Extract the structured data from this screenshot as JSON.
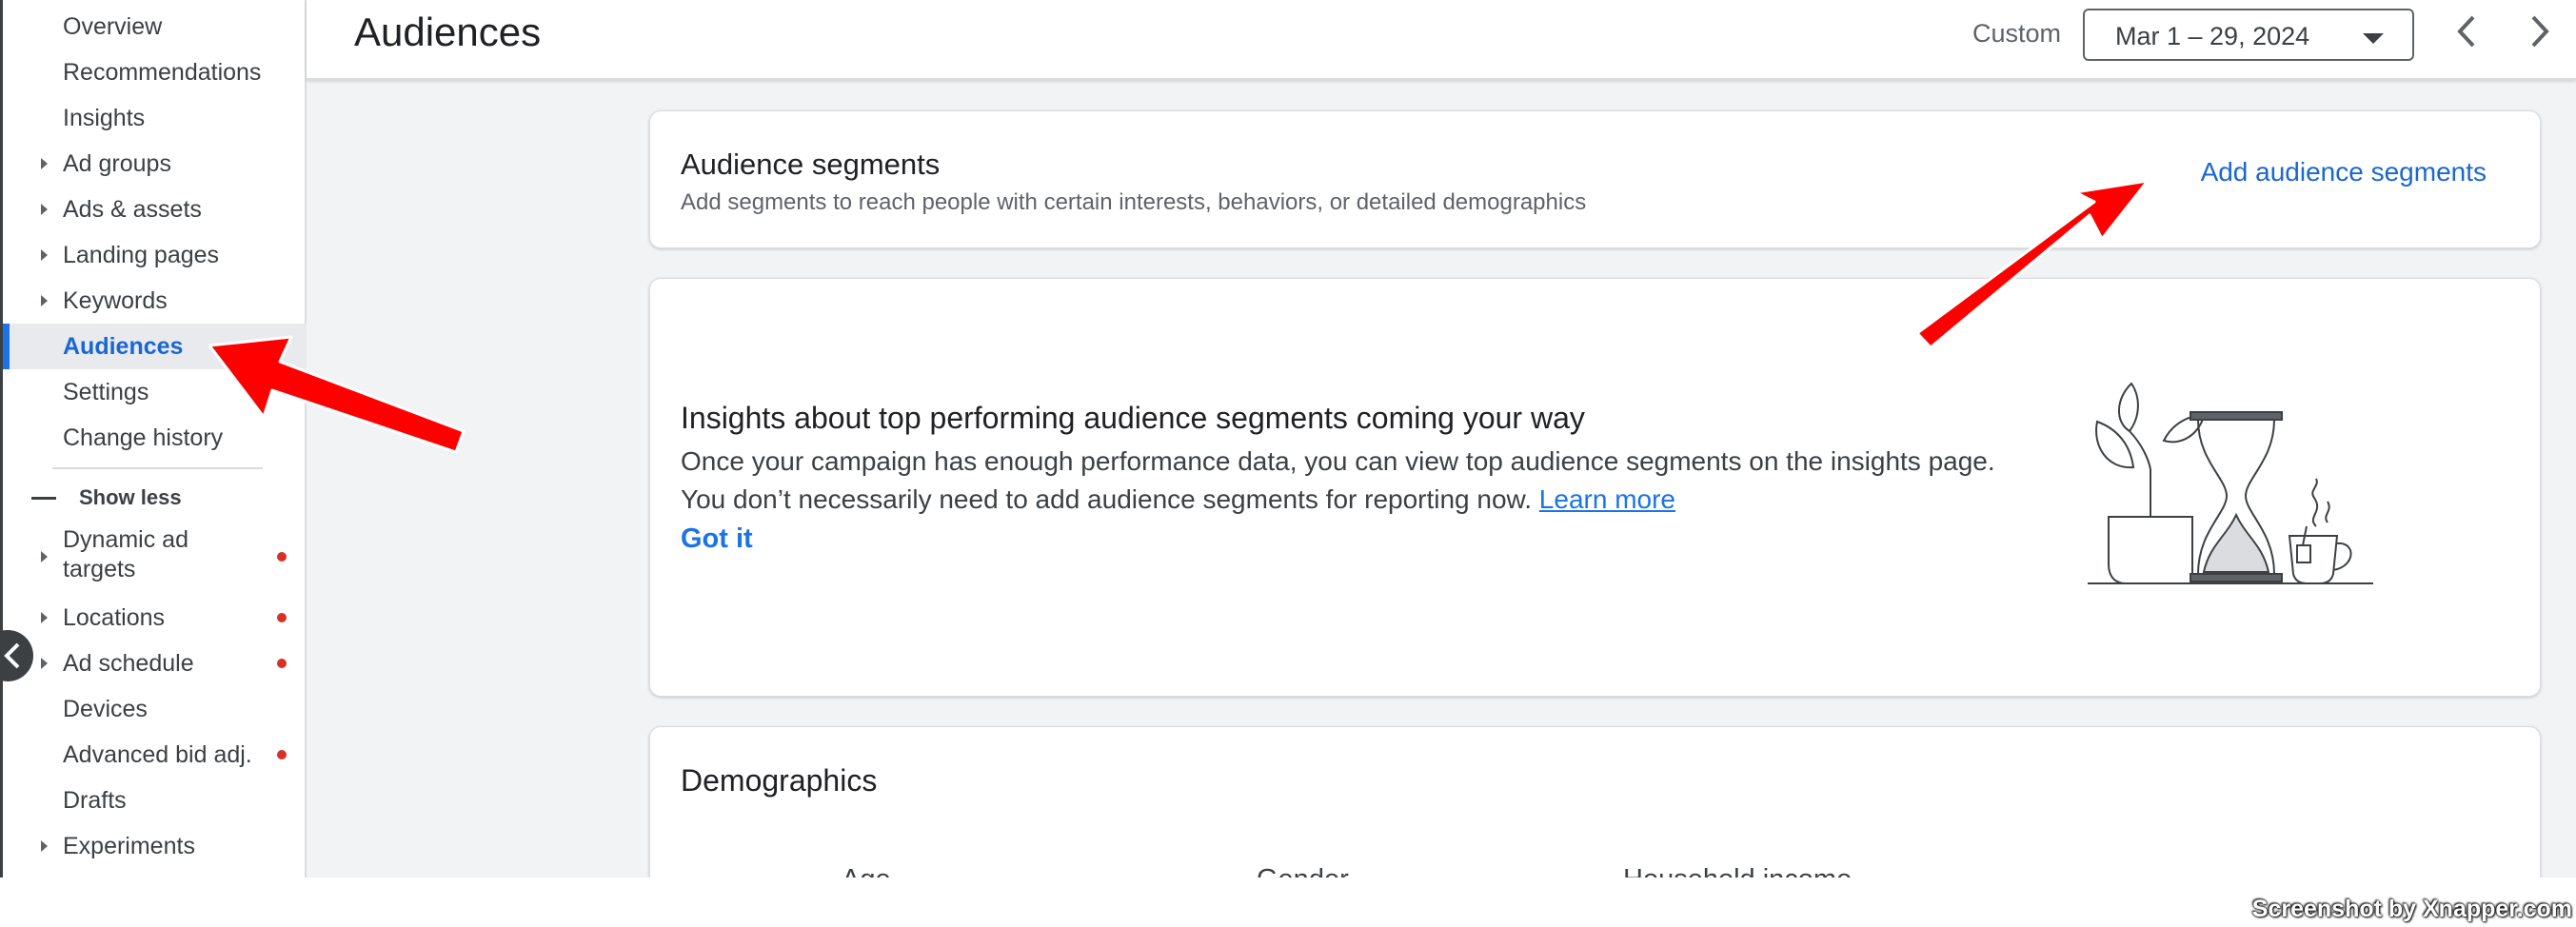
{
  "sidebar": {
    "items": [
      {
        "label": "Overview",
        "caret": false,
        "dot": false
      },
      {
        "label": "Recommendations",
        "caret": false,
        "dot": false
      },
      {
        "label": "Insights",
        "caret": false,
        "dot": false
      },
      {
        "label": "Ad groups",
        "caret": true,
        "dot": false
      },
      {
        "label": "Ads & assets",
        "caret": true,
        "dot": false
      },
      {
        "label": "Landing pages",
        "caret": true,
        "dot": false
      },
      {
        "label": "Keywords",
        "caret": true,
        "dot": false
      },
      {
        "label": "Audiences",
        "caret": false,
        "dot": false,
        "active": true
      },
      {
        "label": "Settings",
        "caret": false,
        "dot": false
      },
      {
        "label": "Change history",
        "caret": false,
        "dot": false
      }
    ],
    "show_less_label": "Show less",
    "more_items": [
      {
        "label": "Dynamic ad targets",
        "caret": true,
        "dot": true
      },
      {
        "label": "Locations",
        "caret": true,
        "dot": true
      },
      {
        "label": "Ad schedule",
        "caret": true,
        "dot": true
      },
      {
        "label": "Devices",
        "caret": false,
        "dot": false
      },
      {
        "label": "Advanced bid adj.",
        "caret": false,
        "dot": true
      },
      {
        "label": "Drafts",
        "caret": false,
        "dot": false
      },
      {
        "label": "Experiments",
        "caret": true,
        "dot": false
      }
    ]
  },
  "header": {
    "title": "Audiences",
    "date_mode": "Custom",
    "date_range": "Mar 1 – 29, 2024"
  },
  "segments": {
    "title": "Audience segments",
    "subtitle": "Add segments to reach people with certain interests, behaviors, or detailed demographics",
    "add_link": "Add audience segments"
  },
  "insights": {
    "title": "Insights about top performing audience segments coming your way",
    "body": "Once your campaign has enough performance data, you can view top audience segments on the insights page. You don’t necessarily need to add audience segments for reporting now.",
    "learn_more": "Learn more",
    "got_it": "Got it"
  },
  "demographics": {
    "title": "Demographics",
    "columns": [
      "Age",
      "Gender",
      "Household income"
    ]
  },
  "watermark": "Screenshot by Xnapper.com",
  "colors": {
    "accent": "#1a73e8",
    "annotation_arrow": "#ff0000",
    "alert_dot": "#d93025"
  }
}
